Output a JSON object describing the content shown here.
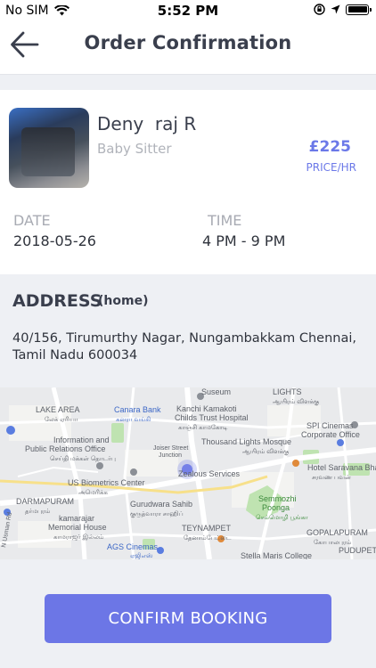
{
  "status_bar": {
    "carrier": "No SIM",
    "time": "5:52 PM"
  },
  "header": {
    "title": "Order Confirmation"
  },
  "booking": {
    "name": "Deny  raj R",
    "role": "Baby Sitter",
    "price": "£225",
    "price_unit": "PRICE/HR",
    "date_label": "DATE",
    "date_value": "2018-05-26",
    "time_label": "TIME",
    "time_value": "4 PM - 9 PM"
  },
  "address": {
    "title": "ADDRESS",
    "tag": "(home)",
    "text": "40/156, Tirumurthy Nagar, Nungambakkam Chennai, Tamil Nadu 600034"
  },
  "map": {
    "labels": {
      "lake_area": "LAKE AREA",
      "lake_area_ta": "லேக் ஏரியா",
      "canara_bank": "Canara Bank",
      "canara_bank_ta": "கனரா வங்கி",
      "kanchi": "Kanchi Kamakoti",
      "childs_trust": "Childs Trust Hospital",
      "kanchi_ta": "காஞ்சி காமகோடி",
      "suseum": "Suseum",
      "lights": "LIGHTS",
      "lights_ta": "ஆயிரம் விளக்கு",
      "spi": "SPI Cinemas",
      "spi2": "Corporate Office",
      "info": "Information and",
      "info2": "Public Relations Office",
      "info_ta": "செய்தி மக்கள் தொடர்பு",
      "thousand": "Thousand Lights Mosque",
      "thousand_ta": "ஆயிரம் விளக்கு",
      "joiser": "Joiser Street",
      "junction": "Junction",
      "hotel": "Hotel Saravana Bha",
      "hotel_ta": "சரவண பவன்",
      "us_bio": "US Biometrics Center",
      "us_bio_ta": "அமெரிக்க",
      "zealous": "Zealous Services",
      "darma": "DARMAPURAM",
      "darma_ta": "தர்மபுரம்",
      "gurudwara": "Gurudwara Sahib",
      "gurudwara_ta": "குருத்வாரா சாஹிப்",
      "sem": "Semmozhi",
      "sem2": "Poonga",
      "sem_ta": "செம்மொழி பூங்கா",
      "kamarajar": "kamarajar",
      "kamarajar2": "Memorial House",
      "kamarajar_ta": "காமராஜர் இல்லம்",
      "teynampet": "TEYNAMPET",
      "teynampet_ta": "தேனாம்பேட்டை",
      "gopal": "GOPALAPURAM",
      "gopal_ta": "கோபாலபுரம்",
      "ags": "AGS Cinemas",
      "agsta": "ஏஜிஎஸ்",
      "stella": "Stella Maris College",
      "pudupet": "PUDUPET",
      "nungam_rd": "N Usman Rd",
      "road_top": "வள்ளுவர் கோட்டம்",
      "orang": "செய்தி"
    }
  },
  "actions": {
    "confirm": "CONFIRM BOOKING"
  }
}
